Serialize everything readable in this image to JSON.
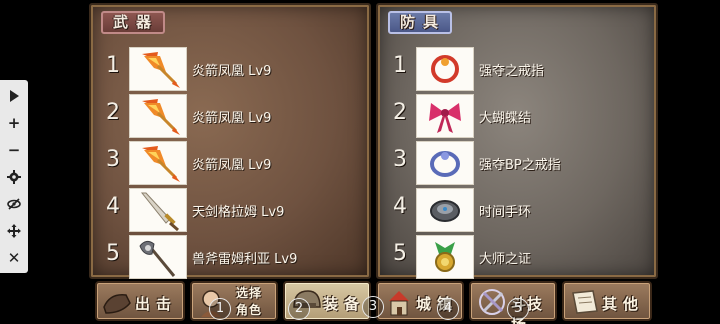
{
  "weapons": {
    "tab_label": "武器",
    "items": [
      {
        "rank": "1",
        "name": "炎箭凤凰 Lv9",
        "icon": "fire-arrow-icon"
      },
      {
        "rank": "2",
        "name": "炎箭凤凰 Lv9",
        "icon": "fire-arrow-icon"
      },
      {
        "rank": "3",
        "name": "炎箭凤凰 Lv9",
        "icon": "fire-arrow-icon"
      },
      {
        "rank": "4",
        "name": "天剑格拉姆 Lv9",
        "icon": "sword-icon"
      },
      {
        "rank": "5",
        "name": "兽斧雷姆利亚 Lv9",
        "icon": "axe-icon"
      }
    ]
  },
  "armor": {
    "tab_label": "防具",
    "items": [
      {
        "rank": "1",
        "name": "强夺之戒指",
        "icon": "ring-icon"
      },
      {
        "rank": "2",
        "name": "大蝴蝶结",
        "icon": "ribbon-icon"
      },
      {
        "rank": "3",
        "name": "强夺BP之戒指",
        "icon": "bp-ring-icon"
      },
      {
        "rank": "4",
        "name": "时间手环",
        "icon": "bracelet-icon"
      },
      {
        "rank": "5",
        "name": "大师之证",
        "icon": "medal-icon"
      }
    ]
  },
  "toolbar": {
    "buttons": [
      "play-icon",
      "plus-icon",
      "minus-icon",
      "gear-icon",
      "eye-off-icon",
      "move-icon",
      "close-icon"
    ],
    "plus_label": "+",
    "minus_label": "−",
    "close_label": "✕"
  },
  "bottom_menu": {
    "sortie_label": "出击",
    "select_line1": "选择",
    "select_line2": "角色",
    "equip_label": "装备",
    "town_label": "城镇",
    "arena_label": "斗技场",
    "other_label": "其他",
    "active": "equip"
  },
  "badges": [
    "1",
    "2",
    "3",
    "4",
    "5"
  ]
}
